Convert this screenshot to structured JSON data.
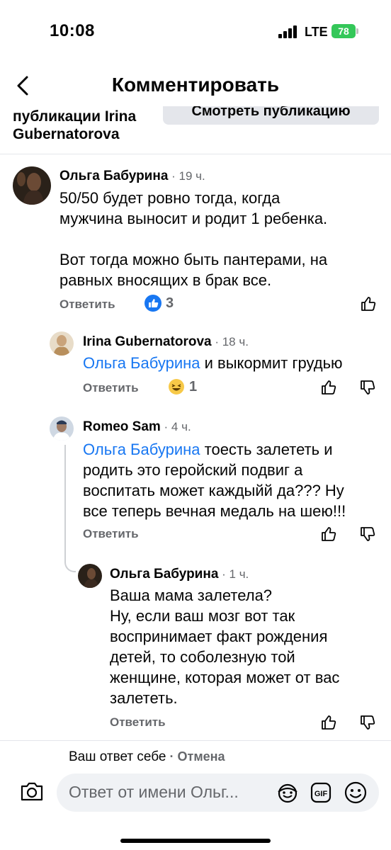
{
  "status": {
    "time": "10:08",
    "network": "LTE",
    "battery": "78"
  },
  "header": {
    "title": "Комментировать"
  },
  "post": {
    "author_line1": "публикации Irina",
    "author_line2": "Gubernatorova",
    "view_button": "Смотреть публикацию"
  },
  "comments": [
    {
      "author": "Ольга Бабурина",
      "time": " · 19 ч.",
      "lines": [
        "50/50 будет ровно тогда, когда",
        "мужчина выносит и родит 1 ребенка.",
        "",
        "Вот тогда можно быть пантерами, на",
        "равных вносящих в брак все."
      ],
      "reply": "Ответить",
      "reaction_count": "3"
    },
    {
      "author": "Irina Gubernatorova",
      "time": " · 18 ч.",
      "mention": "Ольга Бабурина",
      "text": " и выкормит грудью",
      "reply": "Ответить",
      "reaction_count": "1"
    },
    {
      "author": "Romeo Sam",
      "time": " · 4 ч.",
      "mention": "Ольга Бабурина",
      "line1_rest": " тоесть залететь и",
      "lines": [
        "родить это геройский подвиг а",
        "воспитать может каждыйй да??? Ну",
        "все теперь вечная медаль на шею!!!"
      ],
      "reply": "Ответить"
    },
    {
      "author": "Ольга Бабурина",
      "time": " · 1 ч.",
      "lines": [
        "Ваша мама залетела?",
        "Ну, если ваш мозг вот так",
        "воспринимает факт рождения",
        "детей, то соболезную той",
        "женщине, которая может от вас",
        "залететь."
      ],
      "reply": "Ответить"
    }
  ],
  "composer": {
    "reply_to": "Ваш ответ себе",
    "cancel": " · Отмена",
    "placeholder": "Ответ от имени Ольг..."
  },
  "colors": {
    "accent": "#1877f2",
    "muted": "#65676b",
    "battery": "#34c759"
  }
}
